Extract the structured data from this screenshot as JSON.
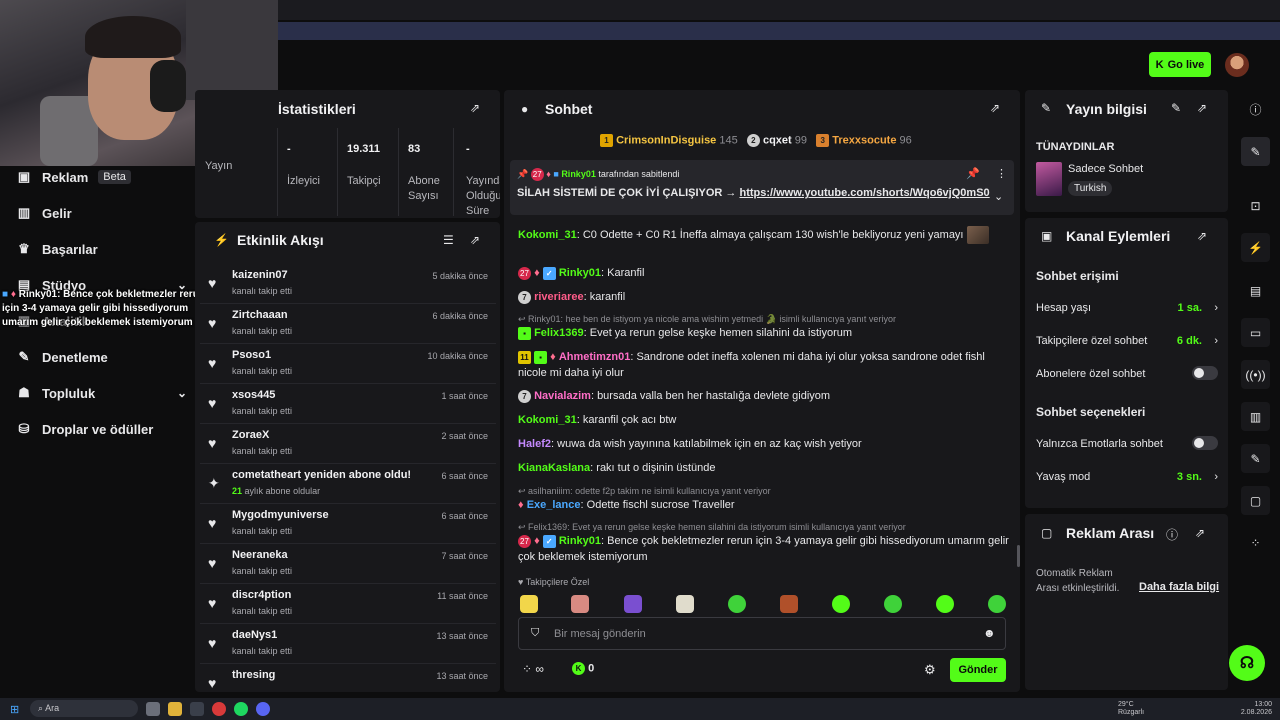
{
  "header": {
    "go_live_label": "Go live"
  },
  "overlay": {
    "user": "Rinky01",
    "text": ": Bence çok bekletmezler rerun için 3-4 yamaya gelir gibi hissediyorum umarım gelir çok beklemek istemiyorum"
  },
  "nav": {
    "items": [
      {
        "label": "Reklam",
        "badge": "Beta",
        "icon": "megaphone-icon"
      },
      {
        "label": "Gelir",
        "icon": "revenue-icon"
      },
      {
        "label": "Başarılar",
        "icon": "trophy-icon"
      },
      {
        "label": "Stüdyo",
        "icon": "studio-icon"
      },
      {
        "label": "Analitik",
        "icon": "analytics-icon"
      },
      {
        "label": "Denetleme",
        "icon": "wrench-icon"
      },
      {
        "label": "Topluluk",
        "icon": "community-icon"
      },
      {
        "label": "Droplar ve ödüller",
        "icon": "drops-icon"
      }
    ]
  },
  "stats": {
    "title": "İstatistikleri",
    "columns": [
      {
        "value": "",
        "label": "Yayın"
      },
      {
        "value": "-",
        "label": "İzleyici"
      },
      {
        "value": "19.311",
        "label": "Takipçi"
      },
      {
        "value": "83",
        "label": "Abone Sayısı"
      },
      {
        "value": "-",
        "label": "Yayında Olduğu Süre"
      }
    ]
  },
  "activity": {
    "title": "Etkinlik Akışı",
    "rows": [
      {
        "name": "kaizenin07",
        "action": "kanalı takip etti",
        "time": "5 dakika önce"
      },
      {
        "name": "Zirtchaaan",
        "action": "kanalı takip etti",
        "time": "6 dakika önce"
      },
      {
        "name": "Psoso1",
        "action": "kanalı takip etti",
        "time": "10 dakika önce"
      },
      {
        "name": "xsos445",
        "action": "kanalı takip etti",
        "time": "1 saat önce"
      },
      {
        "name": "ZoraeX",
        "action": "kanalı takip etti",
        "time": "2 saat önce"
      },
      {
        "name": "cometatheart yeniden abone oldu!",
        "action_count": "21",
        "action": "aylık abone oldular",
        "time": "6 saat önce"
      },
      {
        "name": "Mygodmyuniverse",
        "action": "kanalı takip etti",
        "time": "6 saat önce"
      },
      {
        "name": "Neeraneka",
        "action": "kanalı takip etti",
        "time": "7 saat önce"
      },
      {
        "name": "discr4ption",
        "action": "kanalı takip etti",
        "time": "11 saat önce"
      },
      {
        "name": "daeNys1",
        "action": "kanalı takip etti",
        "time": "13 saat önce"
      },
      {
        "name": "thresing",
        "action": "",
        "time": "13 saat önce"
      }
    ]
  },
  "chat": {
    "title": "Sohbet",
    "leaderboard": [
      {
        "rank": "1",
        "name": "CrimsonInDisguise",
        "count": "145"
      },
      {
        "rank": "2",
        "name": "cqxet",
        "count": "99"
      },
      {
        "rank": "3",
        "name": "Trexxsocute",
        "count": "96"
      }
    ],
    "pinned": {
      "pinned_by": "Rinky01",
      "pinned_by_suffix": "tarafından sabitlendi",
      "text": "SİLAH SİSTEMİ DE ÇOK İYİ ÇALIŞIYOR → ",
      "link": "https://www.youtube.com/shorts/Wqo6vjQ0mS0"
    },
    "messages": [
      {
        "user": "Kokomi_31",
        "color": "#53fc18",
        "text": "C0 Odette + C0 R1 İneffa almaya çalışcam 130 wish'le bekliyoruz yeni yamayı"
      },
      {
        "user": "Rinky01",
        "color": "#53fc18",
        "text": "Karanfil",
        "sub": "27"
      },
      {
        "user": "riveriaree",
        "color": "#ff5c8a",
        "text": "karanfil",
        "level": "7"
      },
      {
        "reply": "Rinky01: hee ben de istiyom ya nicole ama wishim yetmedi",
        "reply_suffix": "isimli kullanıcıya yanıt veriyor",
        "user": "Felix1369",
        "color": "#53fc18",
        "text": "Evet ya rerun gelse keşke hemen silahini da istiyorum"
      },
      {
        "user": "Ahmetimzn01",
        "color": "#ff6ec7",
        "text": "Sandrone odet ineffa xolenen mi daha iyi olur yoksa sandrone odet fishl nicole mi daha iyi olur",
        "level": "11"
      },
      {
        "user": "Navialazim",
        "color": "#ff6ec7",
        "text": "bursada valla ben her hastalığa devlete gidiyom",
        "level": "7"
      },
      {
        "user": "Kokomi_31",
        "color": "#53fc18",
        "text": "karanfil çok acı btw"
      },
      {
        "user": "Halef2",
        "color": "#c58aff",
        "text": "wuwa da wish yayınına katılabilmek için en az kaç wish yetiyor"
      },
      {
        "user": "KianaKaslana",
        "color": "#53fc18",
        "text": "rakı tut o dişinin üstünde"
      },
      {
        "reply": "asilhaniiim: odette f2p takim ne isimli kullanıcıya yanıt veriyor",
        "user": "Exe_lance",
        "color": "#4aa8ff",
        "text": "Odette fischl sucrose Traveller"
      },
      {
        "reply": "Felix1369: Evet ya rerun gelse keşke hemen silahini da istiyorum isimli kullanıcıya yanıt veriyor",
        "user": "Rinky01",
        "color": "#53fc18",
        "text": "Bence çok bekletmezler rerun için 3-4 yamaya gelir gibi hissediyorum umarım gelir çok beklemek istemiyorum",
        "sub": "27"
      }
    ],
    "followers_only_label": "Takipçilere Özel",
    "input_placeholder": "Bir mesaj gönderin",
    "points_label": "∞",
    "kick_points": "0",
    "send_label": "Gönder"
  },
  "stream_info": {
    "title": "Yayın bilgisi",
    "stream_title": "TÜNAYDINLAR",
    "category": "Sadece Sohbet",
    "language_tag": "Turkish"
  },
  "channel_actions": {
    "title": "Kanal Eylemleri",
    "chat_access_title": "Sohbet erişimi",
    "rows": [
      {
        "label": "Hesap yaşı",
        "value": "1 sa."
      },
      {
        "label": "Takipçilere özel sohbet",
        "value": "6 dk."
      },
      {
        "label": "Abonelere özel sohbet",
        "value": ""
      }
    ],
    "chat_options_title": "Sohbet seçenekleri",
    "options": [
      {
        "label": "Yalnızca Emotlarla sohbet",
        "value": ""
      },
      {
        "label": "Yavaş mod",
        "value": "3 sn."
      }
    ]
  },
  "ad_break": {
    "title": "Reklam Arası",
    "description": "Otomatik Reklam Arası etkinleştirildi.",
    "more_link": "Daha fazla bilgi"
  },
  "taskbar": {
    "search_placeholder": "Ara",
    "weather_temp": "29°C",
    "weather_desc": "Rüzgarlı",
    "time": "13:00",
    "date": "2.08.2026"
  },
  "colors": {
    "accent": "#53fc18",
    "panel": "#18181b",
    "background": "#0d0d0e"
  }
}
